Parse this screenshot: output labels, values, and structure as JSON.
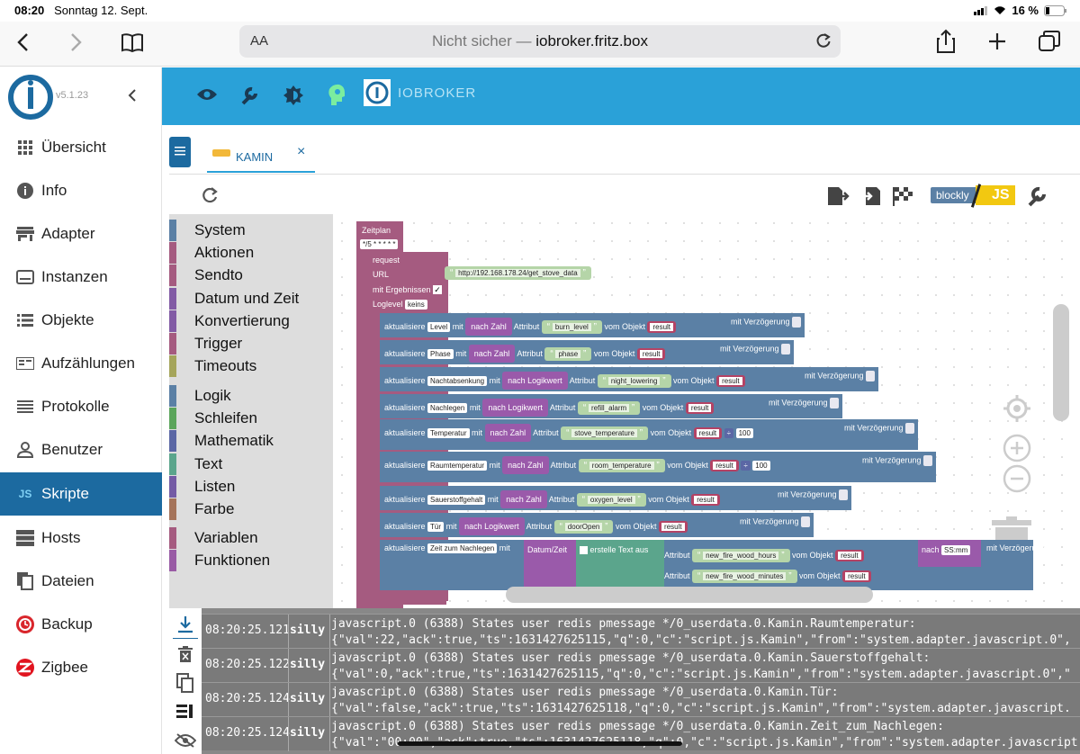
{
  "status_bar": {
    "time": "08:20",
    "date": "Sonntag 12. Sept.",
    "battery": "16 %"
  },
  "browser": {
    "text_size": "AA",
    "url_prefix": "Nicht sicher — ",
    "url_domain": "iobroker.fritz.box"
  },
  "app": {
    "version": "v5.1.23",
    "brand": "IOBROKER"
  },
  "sidebar": {
    "items": [
      {
        "label": "Übersicht",
        "icon": "grid-icon"
      },
      {
        "label": "Info",
        "icon": "info-icon"
      },
      {
        "label": "Adapter",
        "icon": "store-icon"
      },
      {
        "label": "Instanzen",
        "icon": "instances-icon"
      },
      {
        "label": "Objekte",
        "icon": "list-icon"
      },
      {
        "label": "Aufzählungen",
        "icon": "enum-icon"
      },
      {
        "label": "Protokolle",
        "icon": "log-icon"
      },
      {
        "label": "Benutzer",
        "icon": "user-icon"
      },
      {
        "label": "Skripte",
        "icon": "js-icon"
      },
      {
        "label": "Hosts",
        "icon": "server-icon"
      },
      {
        "label": "Dateien",
        "icon": "files-icon"
      },
      {
        "label": "Backup",
        "icon": "backup-icon"
      },
      {
        "label": "Zigbee",
        "icon": "zigbee-icon"
      }
    ]
  },
  "tab": {
    "label": "KAMIN",
    "close": "×"
  },
  "toolbar": {
    "blockly": "blockly",
    "js": "JS"
  },
  "categories": {
    "group1": [
      "System",
      "Aktionen",
      "Sendto",
      "Datum und Zeit",
      "Konvertierung",
      "Trigger",
      "Timeouts"
    ],
    "group2": [
      "Logik",
      "Schleifen",
      "Mathematik",
      "Text",
      "Listen",
      "Farbe"
    ],
    "group3": [
      "Variablen",
      "Funktionen"
    ],
    "colors1": [
      "#5b80a5",
      "#a55b80",
      "#a55b80",
      "#825ba5",
      "#825ba5",
      "#a55b80",
      "#a5a55b"
    ],
    "colors2": [
      "#5b80a5",
      "#5ba55b",
      "#5b67a5",
      "#5ba58c",
      "#745ba5",
      "#a5745b"
    ],
    "colors3": [
      "#a55b80",
      "#995ba5"
    ]
  },
  "blocks": {
    "schedule": {
      "label": "Zeitplan",
      "cron": "*/5 * * * * *"
    },
    "request": {
      "label": "request",
      "url_label": "URL",
      "url": "http://192.168.178.24/get_stove_data",
      "results_label": "mit Ergebnissen",
      "loglevel_label": "Loglevel",
      "loglevel": "keins"
    },
    "common": {
      "update": "aktualisiere",
      "with": "mit",
      "attribute": "Attribut",
      "from_object": "vom Objekt",
      "delay": "mit Verzögerung",
      "result": "result"
    },
    "rows": [
      {
        "state": "Level",
        "conv": "nach Zahl",
        "attr": "burn_level"
      },
      {
        "state": "Phase",
        "conv": "nach Zahl",
        "attr": "phase"
      },
      {
        "state": "Nachtabsenkung",
        "conv": "nach Logikwert",
        "attr": "night_lowering"
      },
      {
        "state": "Nachlegen",
        "conv": "nach Logikwert",
        "attr": "refill_alarm"
      },
      {
        "state": "Temperatur",
        "conv": "nach Zahl",
        "attr": "stove_temperature",
        "op": "÷",
        "num": "100"
      },
      {
        "state": "Raumtemperatur",
        "conv": "nach Zahl",
        "attr": "room_temperature",
        "op": "÷",
        "num": "100"
      },
      {
        "state": "Sauerstoffgehalt",
        "conv": "nach Zahl",
        "attr": "oxygen_level"
      },
      {
        "state": "Tür",
        "conv": "nach Logikwert",
        "attr": "doorOpen"
      }
    ],
    "last": {
      "state": "Zeit zum Nachlegen",
      "date": "Datum/Zeit",
      "create_text": "erstelle Text aus",
      "attr1": "new_fire_wood_hours",
      "attr2": "new_fire_wood_minutes",
      "after": "nach",
      "format": "SS:mm"
    }
  },
  "log": {
    "rows": [
      {
        "time": "08:20:25.121",
        "level": "silly",
        "line1": "javascript.0 (6388) States user redis pmessage */0_userdata.0.Kamin.Raumtemperatur:",
        "line2": "{\"val\":22,\"ack\":true,\"ts\":1631427625115,\"q\":0,\"c\":\"script.js.Kamin\",\"from\":\"system.adapter.javascript.0\","
      },
      {
        "time": "08:20:25.122",
        "level": "silly",
        "line1": "javascript.0 (6388) States user redis pmessage */0_userdata.0.Kamin.Sauerstoffgehalt:",
        "line2": "{\"val\":0,\"ack\":true,\"ts\":1631427625115,\"q\":0,\"c\":\"script.js.Kamin\",\"from\":\"system.adapter.javascript.0\",\""
      },
      {
        "time": "08:20:25.124",
        "level": "silly",
        "line1": "javascript.0 (6388) States user redis pmessage */0_userdata.0.Kamin.Tür:",
        "line2": "{\"val\":false,\"ack\":true,\"ts\":1631427625118,\"q\":0,\"c\":\"script.js.Kamin\",\"from\":\"system.adapter.javascript."
      },
      {
        "time": "08:20:25.124",
        "level": "silly",
        "line1": "javascript.0 (6388) States user redis pmessage */0_userdata.0.Kamin.Zeit_zum_Nachlegen:",
        "line2": "{\"val\":\"00:00\",\"ack\":true,\"ts\":1631427625118,\"q\":0,\"c\":\"script.js.Kamin\",\"from\":\"system.adapter.javascript"
      }
    ]
  }
}
